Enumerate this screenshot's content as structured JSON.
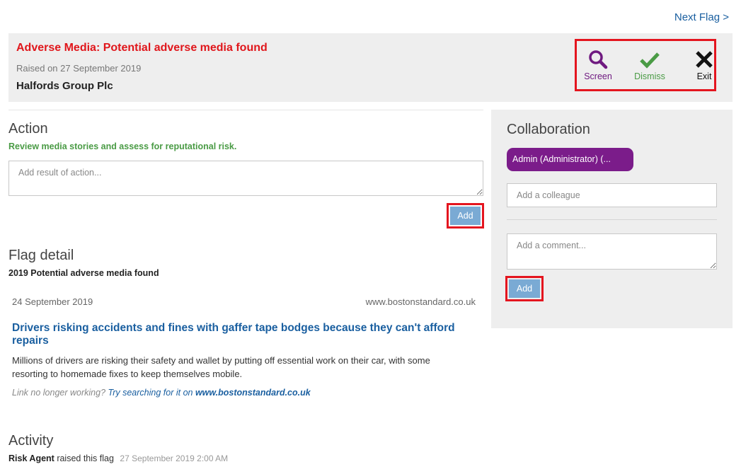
{
  "nav": {
    "next_flag": "Next Flag >"
  },
  "header": {
    "title": "Adverse Media: Potential adverse media found",
    "raised": "Raised on 27 September 2019",
    "company": "Halfords Group Plc",
    "actions": {
      "screen": "Screen",
      "dismiss": "Dismiss",
      "exit": "Exit"
    }
  },
  "action": {
    "heading": "Action",
    "description": "Review media stories and assess for reputational risk.",
    "placeholder": "Add result of action...",
    "add_label": "Add"
  },
  "flag_detail": {
    "heading": "Flag detail",
    "subtitle": "2019 Potential adverse media found",
    "article": {
      "date": "24 September 2019",
      "source": "www.bostonstandard.co.uk",
      "title": "Drivers risking accidents and fines with gaffer tape bodges because they can't afford repairs",
      "body": "Millions of drivers are risking their safety and wallet by putting off essential work on their car, with some resorting to homemade fixes to keep themselves mobile.",
      "link_prefix": "Link no longer working?",
      "link_text": "Try searching for it on",
      "link_site": "www.bostonstandard.co.uk"
    }
  },
  "activity": {
    "heading": "Activity",
    "actor": "Risk Agent",
    "text": "raised this flag",
    "timestamp": "27 September 2019 2:00 AM"
  },
  "collaboration": {
    "heading": "Collaboration",
    "chip": "Admin (Administrator) (...",
    "colleague_placeholder": "Add a colleague",
    "comment_placeholder": "Add a comment...",
    "add_label": "Add"
  },
  "colors": {
    "accent_red": "#e0161b",
    "screen_purple": "#6f1a80",
    "dismiss_green": "#4a9b45",
    "link_blue": "#1a5fa0",
    "button_blue": "#7aaad4"
  }
}
